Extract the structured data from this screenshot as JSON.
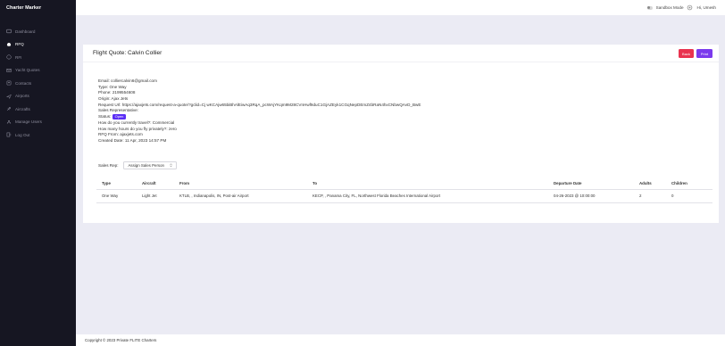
{
  "app": {
    "brand": "Charter Marker"
  },
  "sidebar": {
    "items": [
      {
        "label": "Dashboard",
        "icon": "dashboard-icon"
      },
      {
        "label": "RFQ",
        "icon": "bell-icon",
        "active": true
      },
      {
        "label": "RFI",
        "icon": "help-circle-icon"
      },
      {
        "label": "Yacht Quotes",
        "icon": "mail-icon"
      },
      {
        "label": "Contacts",
        "icon": "contacts-icon"
      },
      {
        "label": "Airports",
        "icon": "plane-icon"
      },
      {
        "label": "Aircrafts",
        "icon": "aircraft-icon"
      },
      {
        "label": "Manage Users",
        "icon": "users-icon"
      },
      {
        "label": "Log Out",
        "icon": "logout-icon"
      }
    ]
  },
  "topbar": {
    "sandbox_label": "Sandbox Mode",
    "greeting": "Hi, Umesh"
  },
  "card": {
    "title": "Flight Quote: Calvin Collier",
    "back_label": "Back",
    "print_label": "Print"
  },
  "info": {
    "email": "Email: colliercalvin6@gmail.com",
    "type": "Type: One Way",
    "phone": "Phone: 2199554608",
    "origin": "Origin: Ajax Jets",
    "request_url": "Request Url: https://ajaxjets.com/request-a-quote/?gclid=Cj wKCAjw65biBhAlEiwAq3RqA_pcWAjYKqm9M28CVnHwf9duC1GjAZEyk1CGqNepDEmZ4bRaN4hxCNbwQAvD_BwE",
    "sales_rep": "Sales Representative:",
    "status_label": "Status:",
    "status_value": "Open",
    "travel": "How do you currently travel?: Commercial",
    "hours": "How many hours do you fly privately?: zero",
    "rfq_from": "RFQ From: ajaxjets.com",
    "created": "Created Date: 11 Apr, 2023 14:57 PM"
  },
  "sales_rep_select": {
    "label": "Sales Rep:",
    "value": "Assign Sales Person"
  },
  "table": {
    "headers": [
      "Type",
      "Aircraft",
      "From",
      "To",
      "Departure Date",
      "Adults",
      "Children"
    ],
    "rows": [
      [
        "One Way",
        "Light Jet",
        "KTLB, , Indianapolis, IN, Post-air Airport",
        "KECP, , Panama City, FL, Northwest Florida Beaches International Airport",
        "04-26-2023 @ 10:00:00",
        "2",
        "0"
      ]
    ]
  },
  "footer": {
    "text": "Copyright © 2023 Private FLITE Charters"
  },
  "colors": {
    "sidebar_bg": "#161622",
    "back_button": "#e9334f",
    "print_button": "#7b3aed",
    "status_badge": "#5b2ef5",
    "page_bg": "#ebebf4"
  }
}
